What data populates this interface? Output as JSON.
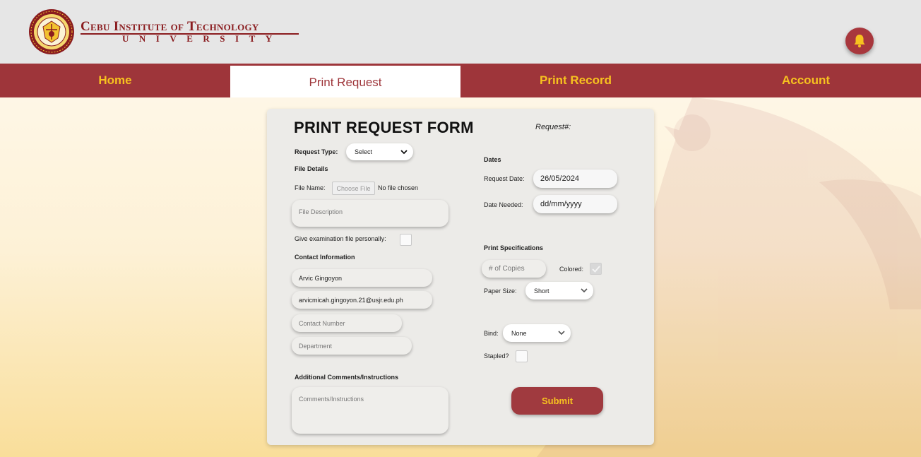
{
  "header": {
    "brand_line1": "Cebu Institute of Technology",
    "brand_line2": "UNIVERSITY",
    "notification_icon": "bell-icon",
    "logo_icon": "university-seal-logo"
  },
  "nav": {
    "items": [
      {
        "label": "Home",
        "active": false
      },
      {
        "label": "Print Request",
        "active": true
      },
      {
        "label": "Print Record",
        "active": false
      },
      {
        "label": "Account",
        "active": false
      }
    ]
  },
  "form": {
    "title": "PRINT REQUEST FORM",
    "request_no_label": "Request#:",
    "request_type": {
      "label": "Request Type:",
      "value": "Select"
    },
    "file_details": {
      "heading": "File Details",
      "file_name_label": "File Name:",
      "choose_file_label": "Choose File",
      "no_file_text": "No file chosen",
      "description_placeholder": "File Description",
      "give_personally_label": "Give examination file personally:"
    },
    "contact": {
      "heading": "Contact Information",
      "name_value": "Arvic Gingoyon",
      "email_value": "arvicmicah.gingoyon.21@usjr.edu.ph",
      "contact_number_placeholder": "Contact Number",
      "department_placeholder": "Department"
    },
    "comments": {
      "heading": "Additional Comments/Instructions",
      "placeholder": "Comments/Instructions"
    },
    "dates": {
      "heading": "Dates",
      "request_date_label": "Request Date:",
      "request_date_value": "26/05/2024",
      "date_needed_label": "Date Needed:",
      "date_needed_value": "dd/mm/yyyy"
    },
    "print_specs": {
      "heading": "Print Specifications",
      "copies_placeholder": "# of Copies",
      "colored_label": "Colored:",
      "paper_size_label": "Paper Size:",
      "paper_size_value": "Short",
      "bind_label": "Bind:",
      "bind_value": "None",
      "stapled_label": "Stapled?"
    },
    "submit_label": "Submit"
  },
  "colors": {
    "maroon": "#9e353a",
    "gold": "#f7c21f",
    "header_bg": "#e6e6e6",
    "card_bg": "#ecebe8"
  }
}
